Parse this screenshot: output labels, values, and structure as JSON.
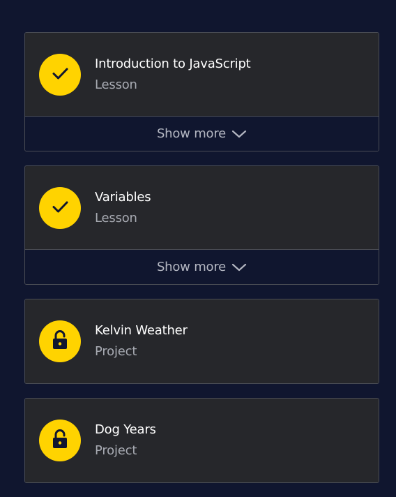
{
  "items": [
    {
      "title": "Introduction to JavaScript",
      "type": "Lesson",
      "status": "completed",
      "status_icon": "checkmark-icon",
      "show_more_label": "Show more"
    },
    {
      "title": "Variables",
      "type": "Lesson",
      "status": "completed",
      "status_icon": "checkmark-icon",
      "show_more_label": "Show more"
    },
    {
      "title": "Kelvin Weather",
      "type": "Project",
      "status": "unlocked",
      "status_icon": "unlocked-padlock-icon"
    },
    {
      "title": "Dog Years",
      "type": "Project",
      "status": "unlocked",
      "status_icon": "unlocked-padlock-icon"
    }
  ],
  "colors": {
    "background": "#10162f",
    "card": "#26272b",
    "accent": "#ffd300",
    "title": "#ffffff",
    "subtitle": "#a8abb3"
  }
}
